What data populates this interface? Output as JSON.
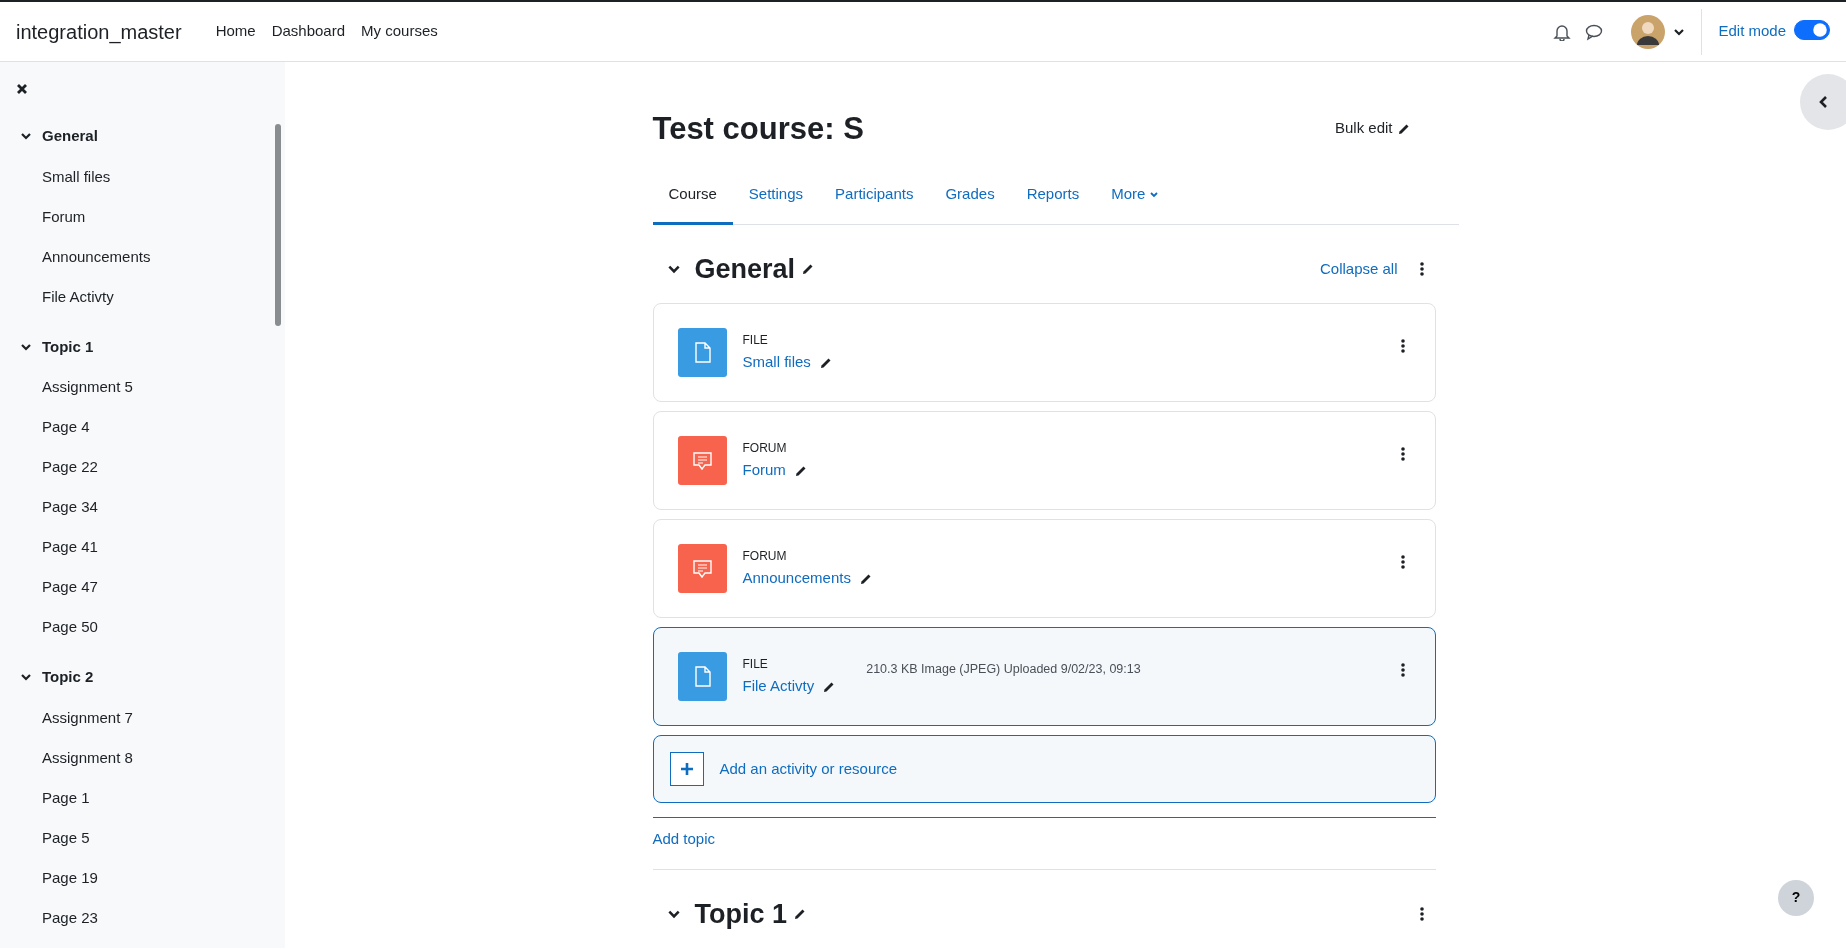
{
  "navbar": {
    "site_name": "integration_master",
    "links": [
      {
        "label": "Home"
      },
      {
        "label": "Dashboard"
      },
      {
        "label": "My courses"
      }
    ],
    "edit_mode": {
      "label": "Edit mode",
      "on": true
    }
  },
  "sidebar": {
    "sections": [
      {
        "title": "General",
        "expanded": true,
        "children": [
          {
            "label": "Small files"
          },
          {
            "label": "Forum"
          },
          {
            "label": "Announcements"
          },
          {
            "label": "File Activty"
          }
        ]
      },
      {
        "title": "Topic 1",
        "expanded": true,
        "children": [
          {
            "label": "Assignment 5"
          },
          {
            "label": "Page 4"
          },
          {
            "label": "Page 22"
          },
          {
            "label": "Page 34"
          },
          {
            "label": "Page 41"
          },
          {
            "label": "Page 47"
          },
          {
            "label": "Page 50"
          }
        ]
      },
      {
        "title": "Topic 2",
        "expanded": true,
        "children": [
          {
            "label": "Assignment 7"
          },
          {
            "label": "Assignment 8"
          },
          {
            "label": "Page 1"
          },
          {
            "label": "Page 5"
          },
          {
            "label": "Page 19"
          },
          {
            "label": "Page 23"
          }
        ]
      }
    ]
  },
  "course": {
    "title": "Test course: S",
    "bulk_edit": "Bulk edit",
    "tabs": [
      {
        "label": "Course",
        "selected": true
      },
      {
        "label": "Settings",
        "selected": false
      },
      {
        "label": "Participants",
        "selected": false
      },
      {
        "label": "Grades",
        "selected": false
      },
      {
        "label": "Reports",
        "selected": false
      },
      {
        "label": "More",
        "selected": false
      }
    ],
    "sections": [
      {
        "title": "General",
        "expanded": true,
        "collapse_all": "Collapse all",
        "activities": [
          {
            "kind": "file",
            "type": "FILE",
            "name": "Small files",
            "highlighted": false
          },
          {
            "kind": "forum",
            "type": "FORUM",
            "name": "Forum",
            "highlighted": false
          },
          {
            "kind": "forum",
            "type": "FORUM",
            "name": "Announcements",
            "highlighted": false
          },
          {
            "kind": "file",
            "type": "FILE",
            "name": "File Activty",
            "info": "210.3 KB Image (JPEG) Uploaded 9/02/23, 09:13",
            "highlighted": true
          }
        ],
        "add_activity": "Add an activity or resource",
        "add_topic": "Add topic"
      },
      {
        "title": "Topic 1",
        "expanded": true
      }
    ]
  },
  "help": "?"
}
